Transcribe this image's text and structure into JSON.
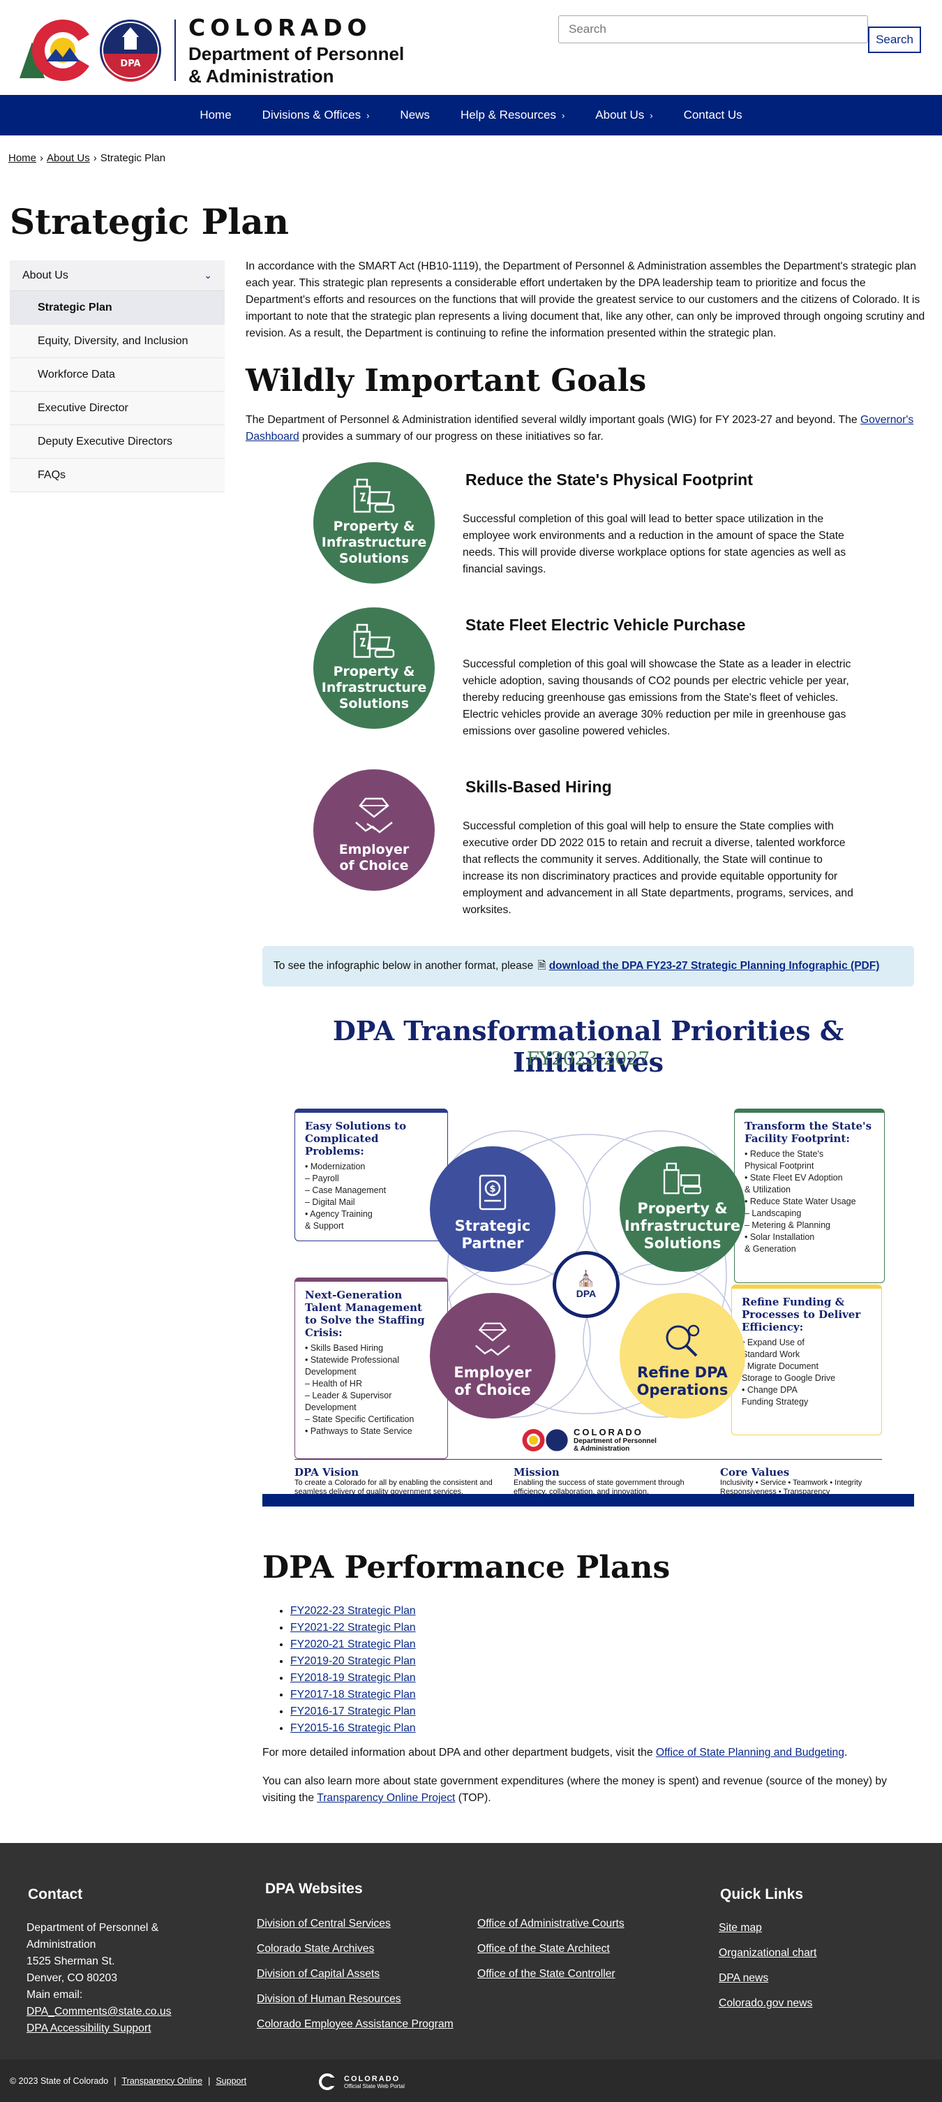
{
  "header": {
    "logo_colorado": "COLORADO",
    "logo_dept": "Department of Personnel",
    "logo_dept2": "& Administration",
    "seal_text": "DPA",
    "search_placeholder": "Search",
    "search_button": "Search"
  },
  "nav": [
    {
      "label": "Home",
      "chevron": false
    },
    {
      "label": "Divisions & Offices",
      "chevron": true
    },
    {
      "label": "News",
      "chevron": false
    },
    {
      "label": "Help & Resources",
      "chevron": true
    },
    {
      "label": "About Us",
      "chevron": true
    },
    {
      "label": "Contact Us",
      "chevron": false
    }
  ],
  "breadcrumb": {
    "home": "Home",
    "about": "About Us",
    "current": "Strategic Plan",
    "sep": "›"
  },
  "page_title": "Strategic Plan",
  "sidebar": {
    "head": "About Us",
    "items": [
      "Strategic Plan",
      "Equity, Diversity, and Inclusion",
      "Workforce Data",
      "Executive Director",
      "Deputy Executive Directors",
      "FAQs"
    ]
  },
  "intro": "In accordance with the SMART Act (HB10-1119), the Department of Personnel & Administration assembles the Department's strategic plan each year. This strategic plan represents a considerable effort undertaken by the DPA leadership team to prioritize and focus the Department's efforts and resources on the functions that will provide the greatest service to our customers and the citizens of Colorado. It is important to note that the strategic plan represents a living document that, like any other, can only be improved through ongoing scrutiny and revision. As a result, the Department is continuing to refine the information presented within the strategic plan.",
  "wig": {
    "title": "Wildly Important Goals",
    "intro_before": "The Department of Personnel & Administration identified several wildly important goals (WIG) for FY 2023-27 and beyond. The ",
    "intro_link": "Governor's Dashboard",
    "intro_after": " provides a summary of our progress on these initiatives so far.",
    "goals": [
      {
        "circle_line1": "Property &",
        "circle_line2": "Infrastructure",
        "circle_line3": "Solutions",
        "title": "Reduce the State's Physical Footprint",
        "text": "Successful completion of this goal will lead to better space utilization in the employee work environments and a reduction in the amount of space the State needs. This will provide diverse workplace options for state agencies as well as financial savings."
      },
      {
        "circle_line1": "Property &",
        "circle_line2": "Infrastructure",
        "circle_line3": "Solutions",
        "title": "State Fleet Electric Vehicle Purchase",
        "text": "Successful completion of this goal will showcase the State as a leader in electric vehicle adoption, saving thousands of CO2 pounds per electric vehicle per year, thereby reducing greenhouse gas emissions from the State's fleet of vehicles. Electric vehicles provide an average 30% reduction per mile in greenhouse gas emissions over gasoline powered vehicles."
      },
      {
        "circle_line1": "Employer",
        "circle_line2": "of Choice",
        "circle_line3": "",
        "title": "Skills-Based Hiring",
        "text": "Successful completion of this goal will help to ensure the State complies with executive order DD 2022 015 to retain and recruit a diverse, talented workforce that reflects the community it serves. Additionally, the State will continue to increase its non discriminatory practices and provide equitable opportunity for employment and advancement in all State departments, programs, services, and worksites."
      }
    ]
  },
  "notice": {
    "text": "To see the infographic below in another format, please",
    "link": "download the DPA FY23-27 Strategic Planning Infographic (PDF)"
  },
  "infographic": {
    "title": "DPA Transformational Priorities & Initiatives",
    "subtitle": "FY2023-2027",
    "box1": {
      "head": "Easy Solutions to Complicated Problems:",
      "items": [
        "• Modernization",
        "   – Payroll",
        "   – Case Management",
        "   – Digital Mail",
        "• Agency Training",
        "   & Support"
      ]
    },
    "box2": {
      "head": "Transform the State's Facility Footprint:",
      "items": [
        "• Reduce the State's",
        "   Physical Footprint",
        "• State Fleet EV Adoption",
        "   & Utilization",
        "• Reduce State Water Usage",
        "   – Landscaping",
        "   – Metering & Planning",
        "• Solar Installation",
        "   & Generation"
      ]
    },
    "box3": {
      "head": "Next-Generation Talent Management to Solve the Staffing Crisis:",
      "items": [
        "• Skills Based Hiring",
        "• Statewide Professional",
        "   Development",
        "   – Health of HR",
        "   – Leader & Supervisor",
        "     Development",
        "   – State Specific Certification",
        "• Pathways to State Service"
      ]
    },
    "box4": {
      "head": "Refine Funding & Processes to Deliver Efficiency:",
      "items": [
        "• Expand Use of",
        "   Standard Work",
        "• Migrate Document",
        "   Storage to Google Drive",
        "• Change DPA",
        "   Funding Strategy"
      ]
    },
    "circle_strategic": [
      "Strategic",
      "Partner"
    ],
    "circle_property": [
      "Property &",
      "Infrastructure",
      "Solutions"
    ],
    "circle_employer": [
      "Employer",
      "of Choice"
    ],
    "circle_refine": [
      "Refine DPA",
      "Operations"
    ],
    "center": "DPA",
    "logo_colorado": "COLORADO",
    "logo_dept": "Department of Personnel",
    "logo_dept2": "& Administration",
    "vision_label": "DPA Vision",
    "vision_text": "To create a Colorado for all by enabling the consistent and seamless delivery of quality government services.",
    "mission_label": "Mission",
    "mission_text": "Enabling the success of state government through efficiency, collaboration, and innovation.",
    "values_label": "Core Values",
    "values_text": "Inclusivity • Service • Teamwork • Integrity Responsiveness • Transparency"
  },
  "perf": {
    "title": "DPA Performance Plans",
    "items": [
      "FY2022-23 Strategic Plan",
      "FY2021-22 Strategic Plan",
      "FY2020-21 Strategic Plan",
      "FY2019-20 Strategic Plan",
      "FY2018-19 Strategic Plan",
      "FY2017-18 Strategic Plan",
      "FY2016-17 Strategic Plan",
      "FY2015-16 Strategic Plan"
    ],
    "detail1_before": "For more detailed information about DPA and other department budgets, visit the ",
    "detail1_link": "Office of State Planning and Budgeting",
    "detail1_after": ".",
    "detail2_before": "You can also learn more about state government expenditures (where the money is spent) and revenue (source of the money) by visiting the ",
    "detail2_link": "Transparency Online Project",
    "detail2_after": " (TOP)."
  },
  "footer": {
    "contact_head": "Contact",
    "contact_lines": [
      "Department of Personnel &",
      "Administration",
      "1525 Sherman St.",
      "Denver, CO 80203",
      "Main email:"
    ],
    "contact_email": "DPA_Comments@state.co.us",
    "contact_access": "DPA Accessibility Support",
    "websites_head": "DPA Websites",
    "websites_col1": [
      "Division of Central Services",
      "Colorado State Archives",
      "Division of Capital Assets",
      "Division of Human Resources",
      "Colorado Employee Assistance Program"
    ],
    "websites_col2": [
      "Office of Administrative Courts",
      "Office of the State Architect",
      "Office of the State Controller"
    ],
    "quick_head": "Quick Links",
    "quick_links": [
      "Site map",
      "Organizational chart",
      "DPA news",
      "Colorado.gov news"
    ],
    "copyright": "© 2023 State of Colorado",
    "bottom_links": [
      "Transparency Online",
      "Support"
    ],
    "bottom_logo_1": "COLORADO",
    "bottom_logo_2": "Official State Web Portal"
  }
}
